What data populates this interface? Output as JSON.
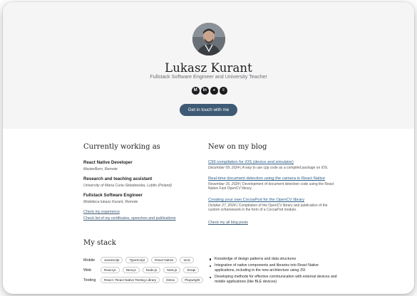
{
  "profile": {
    "name": "Lukasz Kurant",
    "subtitle": "Fullstack Software Engineer and University Teacher",
    "cta_label": "Get in touch with me",
    "socials": [
      {
        "icon": "medium-icon",
        "glyph": "M"
      },
      {
        "icon": "linkedin-icon",
        "glyph": "in"
      },
      {
        "icon": "github-icon",
        "glyph": "◕"
      },
      {
        "icon": "stackoverflow-icon",
        "glyph": "≡"
      }
    ]
  },
  "work": {
    "title": "Currently working as",
    "jobs": [
      {
        "title": "React Native Developer",
        "place": "MasterBorn, Remote"
      },
      {
        "title": "Research and teaching assistant",
        "place": "University of Maria Curie-Skłodowska, Lublin (Poland)"
      },
      {
        "title": "Fullstack Software Engineer",
        "place": "Mobideca lukasz Kurant, Remote"
      }
    ],
    "experience_link": "Check my experience",
    "certificates_link": "Check list of my certificates, speeches and publications"
  },
  "blog": {
    "title": "New on my blog",
    "posts": [
      {
        "title": "C99 compilation for iOS (device and simulator)",
        "date": "December 09, 2024",
        "desc": "A way to use cpp code as a compiled package on iOS."
      },
      {
        "title": "Real-time document detection using the camera in React Native",
        "date": "November 16, 2024",
        "desc": "Development of document detection code using the React Native Fast OpenCV library."
      },
      {
        "title": "Creating your own CocoaPod for the OpenCV library",
        "date": "October 27, 2024",
        "desc": "Compilation of the OpenCV library and publication of the custom xcframework in the form of a CocoaPod module."
      }
    ],
    "all_posts_link": "Check my all blog posts"
  },
  "stack": {
    "title": "My stack",
    "rows": [
      {
        "label": "Mobile",
        "tags": [
          "JavaScript",
          "TypeScript",
          "React Native",
          "Ionic"
        ]
      },
      {
        "label": "Web",
        "tags": [
          "React.js",
          "Next.js",
          "Node.js",
          "Nest.js",
          "Strapi"
        ]
      },
      {
        "label": "Testing",
        "tags": [
          "React / React Native Testing Library",
          "Detox",
          "Playwright"
        ]
      }
    ],
    "bullets": [
      "Knowledge of design patterns and data structures",
      "Integration of native components and libraries into React Native applications, including in the new architecture using JSI",
      "Developing methods for effective communication with external devices and mobile applications (like BLE devices)"
    ]
  },
  "colors": {
    "hero_bg": "#f5f5f6",
    "accent": "#3f5a75",
    "link": "#2f5f8a"
  }
}
